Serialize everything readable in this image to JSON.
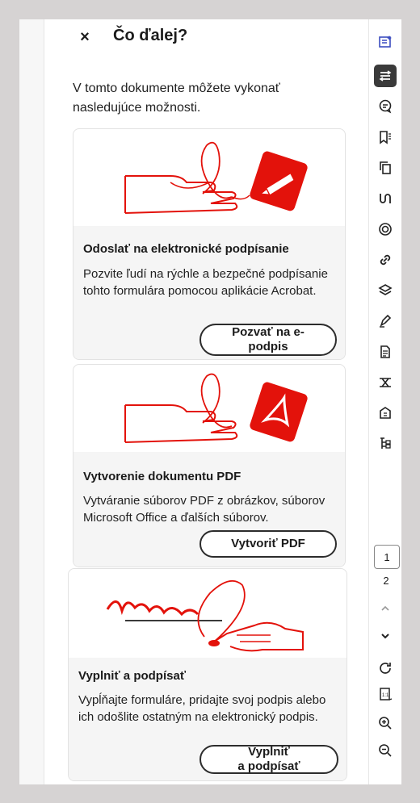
{
  "panel": {
    "close_glyph": "×",
    "title": "Čo ďalej?",
    "intro": "V tomto dokumente môžete vykonať nasledujúce možnosti."
  },
  "cards": [
    {
      "heading": "Odoslať na elektronické podpísanie",
      "text": "Pozvite ľudí na rýchle a bezpečné podpísanie tohto formulára pomocou aplikácie Acrobat.",
      "button_line1": "Pozvať na e-",
      "button_line2": "podpis"
    },
    {
      "heading": "Vytvorenie dokumentu PDF",
      "text": "Vytváranie súborov PDF z obrázkov, súborov Microsoft Office a ďalších súborov.",
      "button_line1": "Vytvoriť PDF"
    },
    {
      "heading": "Vyplniť a podpísať",
      "text": "Vypĺňajte formuláre, pridajte svoj podpis alebo ich odošlite ostatným na elektronický podpis.",
      "button_line1": "Vyplniť",
      "button_line2": "a podpísať"
    }
  ],
  "rail": {
    "icons": [
      "ai-assistant-icon",
      "organize-icon",
      "comment-icon",
      "bookmark-list-icon",
      "copy-pages-icon",
      "combine-icon",
      "redact-icon",
      "link-icon",
      "layers-icon",
      "sign-pen-icon",
      "document-icon",
      "compare-icon",
      "protect-icon",
      "structure-tree-icon"
    ],
    "current_page": "1",
    "next_page_label": "2"
  },
  "colors": {
    "accent": "#e3120b",
    "dark": "#2c2c2c"
  }
}
